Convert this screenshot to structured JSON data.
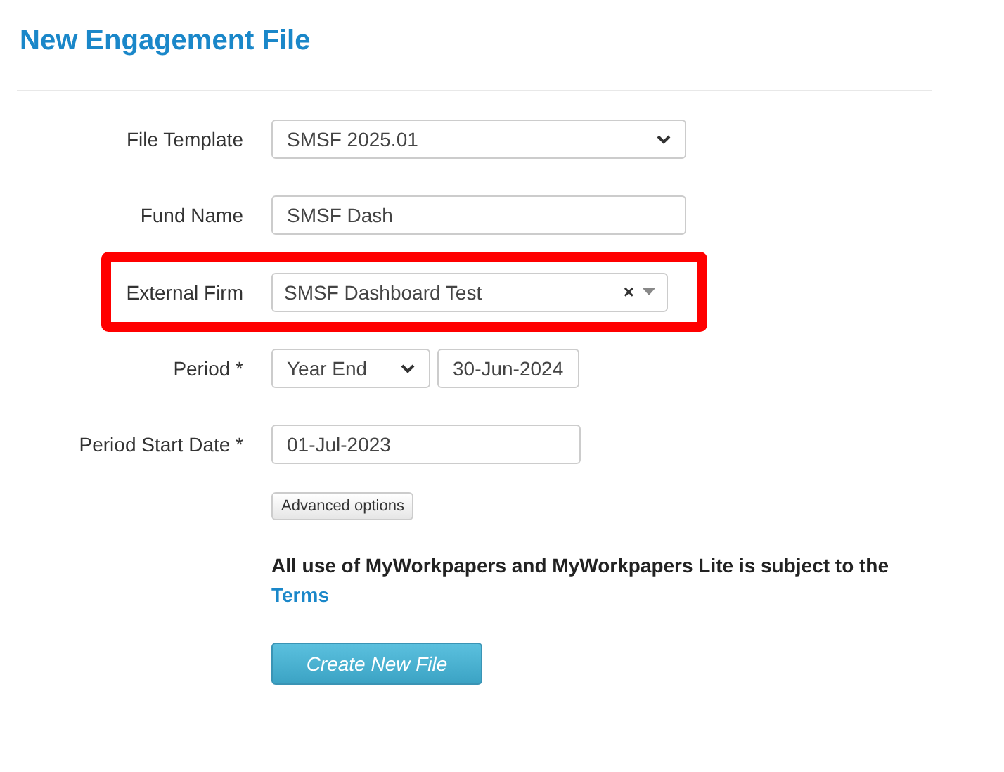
{
  "title": "New Engagement File",
  "fields": [
    {
      "kind": "select",
      "label": "File Template",
      "value": "SMSF 2025.01",
      "highlighted": false
    },
    {
      "kind": "text",
      "label": "Fund Name",
      "value": "SMSF Dash",
      "highlighted": false
    },
    {
      "kind": "combo",
      "label": "External Firm",
      "value": "SMSF Dashboard Test",
      "clear": "×",
      "highlighted": true
    },
    {
      "kind": "period",
      "label": "Period *",
      "value": "Year End",
      "date": "30-Jun-2024",
      "highlighted": false
    },
    {
      "kind": "date",
      "label": "Period Start Date *",
      "value": "01-Jul-2023",
      "highlighted": false
    }
  ],
  "advanced_button": "Advanced options",
  "terms_text": "All use of MyWorkpapers and MyWorkpapers Lite is subject to the",
  "terms_link": "Terms",
  "submit_button": "Create New File"
}
